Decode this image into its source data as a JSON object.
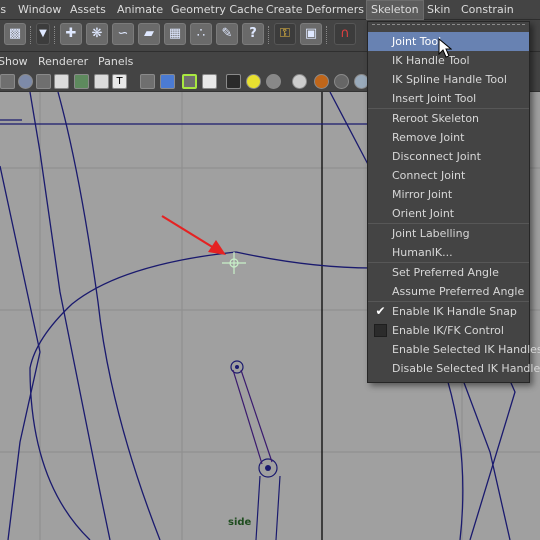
{
  "menubar": {
    "items": [
      "ts",
      "Window",
      "Assets",
      "Animate",
      "Geometry Cache",
      "Create Deformers",
      "Skeleton",
      "Skin",
      "Constrain"
    ],
    "active": "Skeleton"
  },
  "panel_menu": {
    "items": [
      "Show",
      "Renderer",
      "Panels"
    ]
  },
  "viewport": {
    "view_label": "side",
    "arrow_color": "#e52222",
    "curve_color": "#1a1a6e"
  },
  "skeleton_menu": {
    "items": [
      {
        "label": "Joint Tool",
        "highlighted": true
      },
      {
        "label": "IK Handle Tool"
      },
      {
        "label": "IK Spline Handle Tool"
      },
      {
        "label": "Insert Joint Tool"
      },
      {
        "label": "Reroot Skeleton"
      },
      {
        "label": "Remove Joint"
      },
      {
        "label": "Disconnect Joint"
      },
      {
        "label": "Connect Joint"
      },
      {
        "label": "Mirror Joint"
      },
      {
        "label": "Orient Joint"
      },
      {
        "label": "Joint Labelling"
      },
      {
        "label": "HumanIK..."
      },
      {
        "label": "Set Preferred Angle"
      },
      {
        "label": "Assume Preferred Angle"
      },
      {
        "label": "Enable IK Handle Snap",
        "checked": true
      },
      {
        "label": "Enable IK/FK Control",
        "checked": false
      },
      {
        "label": "Enable Selected IK Handles"
      },
      {
        "label": "Disable Selected IK Handles"
      }
    ],
    "highlight_color": "#6882b2"
  },
  "shelf_icons": [
    "select-icon",
    "move-tool-icon",
    "joint-tool-icon",
    "ik-handle-icon",
    "curve-icon",
    "plane-icon",
    "lattice-icon",
    "particles-icon",
    "paint-icon",
    "help-icon",
    "lock-icon",
    "snap-icon",
    "magnet-icon"
  ],
  "panel_icons": [
    "grid-icon",
    "sphere-icon",
    "wire-icon",
    "checker-icon",
    "texture-icon",
    "text-icon",
    "cube-icon",
    "blue-cube-icon",
    "camera-icon",
    "wire-cube-icon",
    "checker-ball-icon",
    "light-icon",
    "dot-icon",
    "gray-sphere-icon",
    "orange-sphere-icon",
    "half-sphere-icon",
    "ball-icon"
  ]
}
